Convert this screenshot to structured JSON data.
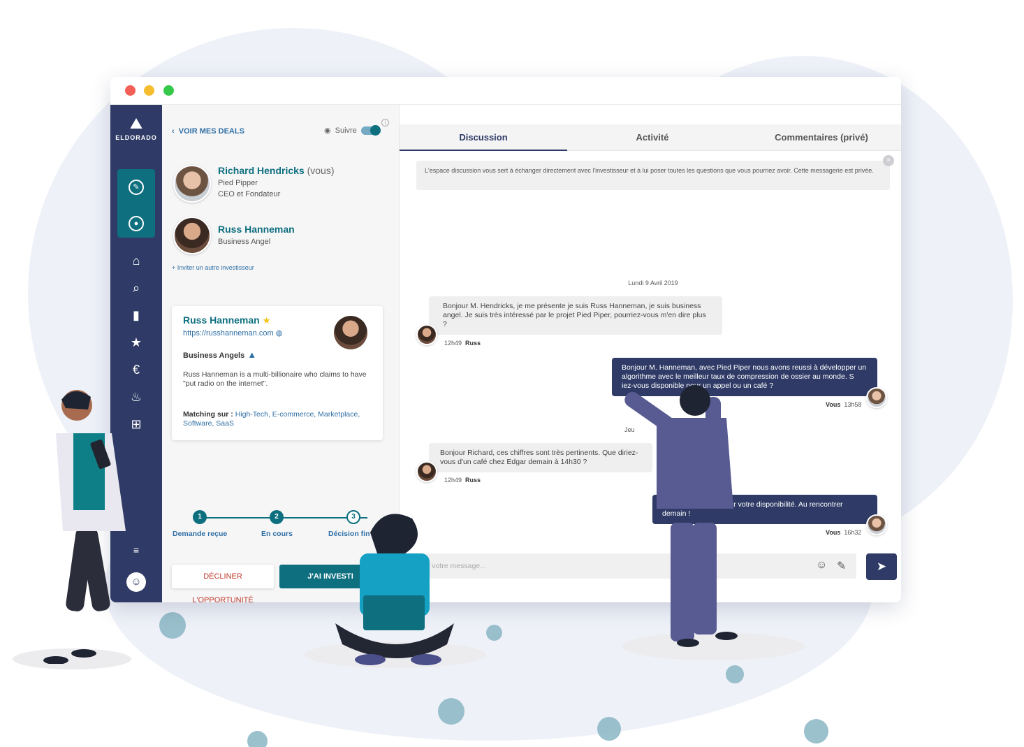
{
  "brand": {
    "name": "ELDORADO"
  },
  "colors": {
    "sidebar": "#2f3b66",
    "accent": "#0e6f7f",
    "link": "#2f6fa4",
    "decline": "#c0392b"
  },
  "sidebar": {
    "active_icons": [
      "leaf-icon",
      "target-icon"
    ],
    "items": [
      "home-icon",
      "search-icon",
      "book-icon",
      "star-icon",
      "euro-icon",
      "fire-icon",
      "gift-icon"
    ],
    "bottom": [
      "menu-icon",
      "profile-icon"
    ]
  },
  "left_panel": {
    "back_label": "VOIR MES DEALS",
    "follow_label": "Suivre",
    "follow_on": true,
    "people": [
      {
        "name": "Richard Hendricks",
        "suffix": "(vous)",
        "company": "Pied Pipper",
        "role": "CEO et Fondateur"
      },
      {
        "name": "Russ Hanneman",
        "role": "Business Angel"
      }
    ],
    "invite_label": "+ Inviter un autre investisseur",
    "card": {
      "name": "Russ Hanneman",
      "url": "https://russhanneman.com",
      "type": "Business Angels",
      "description": "Russ Hanneman is a multi-billionaire who claims to have \"put radio on the internet\".",
      "matching_label": "Matching sur :",
      "matching_tags": "High-Tech, E-commerce, Marketplace, Software, SaaS"
    },
    "steps": [
      {
        "num": "1",
        "label": "Demande reçue"
      },
      {
        "num": "2",
        "label": "En cours"
      },
      {
        "num": "3",
        "label": "Décision fin"
      }
    ],
    "decline_label": "DÉCLINER L'OPPORTUNITÉ",
    "invest_label": "J'AI INVESTI"
  },
  "chat": {
    "tabs": [
      "Discussion",
      "Activité",
      "Commentaires (privé)"
    ],
    "active_tab": "Discussion",
    "notice": "L'espace discussion vous sert à échanger directement avec l'investisseur et à lui poser toutes les questions que vous pourriez avoir. Cette messagerie est privée.",
    "day_separator": "Lundi 9 Avril 2019",
    "day_separator_2": "Jeu",
    "messages": [
      {
        "dir": "in",
        "text": "Bonjour M. Hendricks, je me présente je suis Russ Hanneman, je suis business angel. Je suis très intéressé par le projet Pied Piper, pourriez-vous m'en dire plus ?",
        "time": "12h49",
        "author": "Russ"
      },
      {
        "dir": "out",
        "text": "Bonjour M. Hanneman, avec Pied Piper nous avons reussi à développer un algorithme avec le meilleur taux de compression de ossier au monde. S  iez-vous disponible pour un appel ou un café ?",
        "time": "13h58",
        "author": "Vous"
      },
      {
        "dir": "in",
        "text": "Bonjour Richard, ces chiffres sont très pertinents. Que diriez-vous d'un café chez Edgar demain à 14h30 ?",
        "time": "12h49",
        "author": "Russ"
      },
      {
        "dir": "out",
        "text": "Bo          vous remercie pour votre disponibilité. Au           rencontrer demain !",
        "time": "16h32",
        "author": "Vous"
      }
    ],
    "composer_placeholder": "er votre message..."
  }
}
